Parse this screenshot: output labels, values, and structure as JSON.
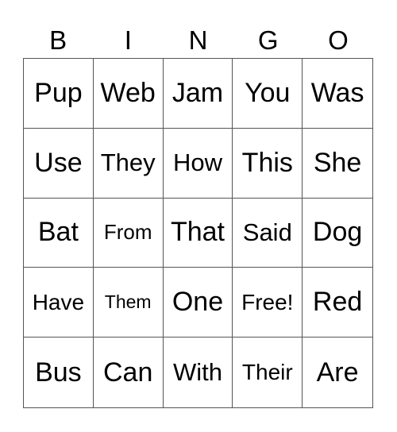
{
  "header": [
    "B",
    "I",
    "N",
    "G",
    "O"
  ],
  "cells": [
    [
      "Pup",
      "Web",
      "Jam",
      "You",
      "Was"
    ],
    [
      "Use",
      "They",
      "How",
      "This",
      "She"
    ],
    [
      "Bat",
      "From",
      "That",
      "Said",
      "Dog"
    ],
    [
      "Have",
      "Them",
      "One",
      "Free!",
      "Red"
    ],
    [
      "Bus",
      "Can",
      "With",
      "Their",
      "Are"
    ]
  ]
}
